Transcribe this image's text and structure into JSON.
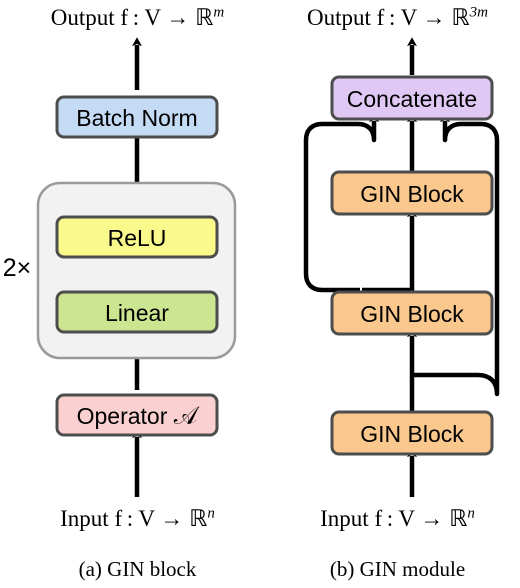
{
  "figure": {
    "panels": [
      {
        "id": "gin-block",
        "caption": "(a) GIN block",
        "output_label": "Output f : V → ℝ",
        "output_sup": "m",
        "input_label": "Input f : V → ℝ",
        "input_sup": "n",
        "repeat_label": "2×",
        "nodes": [
          {
            "label": "Batch Norm",
            "color": "#c5daf5"
          },
          {
            "label": "ReLU",
            "color": "#fafa8c"
          },
          {
            "label": "Linear",
            "color": "#cce591"
          },
          {
            "label": "Operator",
            "math": "𝒜",
            "color": "#fad0d0"
          }
        ]
      },
      {
        "id": "gin-module",
        "caption": "(b) GIN module",
        "output_label": "Output f : V → ℝ",
        "output_sup": "3m",
        "input_label": "Input f : V → ℝ",
        "input_sup": "n",
        "nodes": [
          {
            "label": "Concatenate",
            "color": "#e0c8f5"
          },
          {
            "label": "GIN Block",
            "color": "#fac88c"
          },
          {
            "label": "GIN Block",
            "color": "#fac88c"
          },
          {
            "label": "GIN Block",
            "color": "#fac88c"
          }
        ]
      }
    ],
    "colors": {
      "stroke": "#4d4d4d",
      "arrow": "#000000",
      "group_fill": "#f2f2f2",
      "group_stroke": "#808080"
    }
  }
}
